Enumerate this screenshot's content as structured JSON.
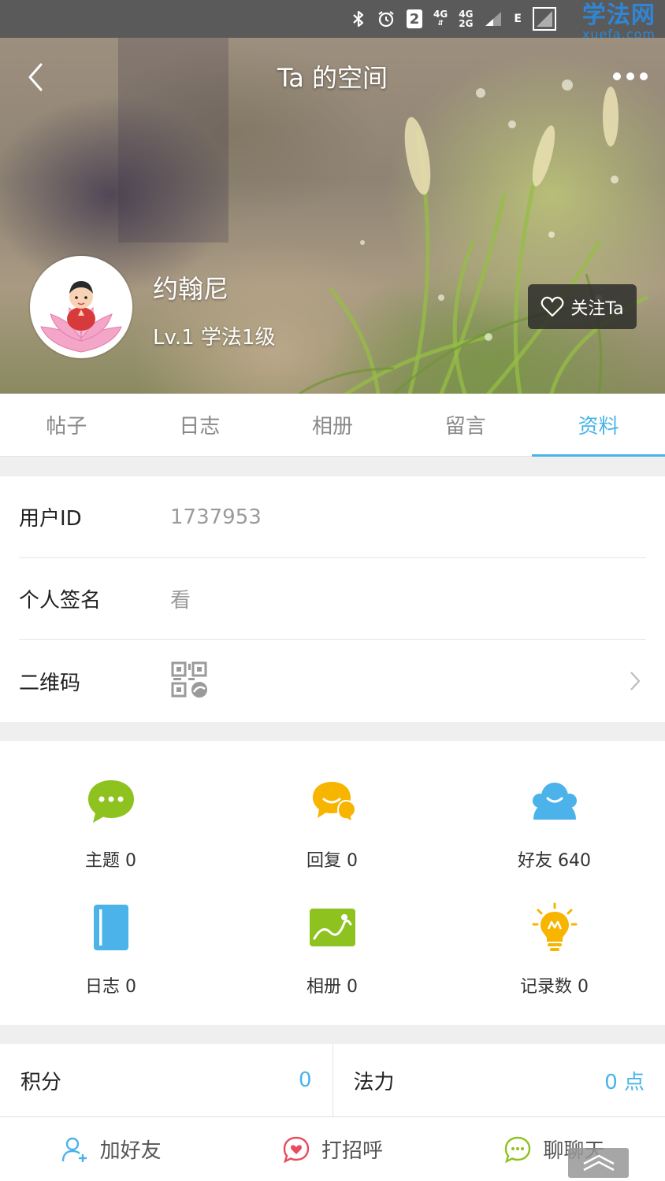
{
  "status_bar": {
    "sim_badge": "2",
    "net1": "4G",
    "net2_top": "4G",
    "net2_bottom": "2G",
    "net3": "E"
  },
  "watermark": {
    "logo": "学法网",
    "url": "xuefa.com"
  },
  "header": {
    "title": "Ta 的空间",
    "username": "约翰尼",
    "level": "Lv.1 学法1级",
    "follow_label": "关注Ta"
  },
  "tabs": [
    {
      "label": "帖子"
    },
    {
      "label": "日志"
    },
    {
      "label": "相册"
    },
    {
      "label": "留言"
    },
    {
      "label": "资料",
      "active": true
    }
  ],
  "profile": {
    "user_id_label": "用户ID",
    "user_id_value": "1737953",
    "signature_label": "个人签名",
    "signature_value": "看",
    "qrcode_label": "二维码"
  },
  "stats": [
    {
      "label": "主题",
      "value": "0",
      "icon": "chat-bubble-icon",
      "color": "#8dc21f"
    },
    {
      "label": "回复",
      "value": "0",
      "icon": "reply-bubbles-icon",
      "color": "#f7b500"
    },
    {
      "label": "好友",
      "value": "640",
      "icon": "friends-icon",
      "color": "#4bb2ea"
    },
    {
      "label": "日志",
      "value": "0",
      "icon": "notebook-icon",
      "color": "#4bb2ea"
    },
    {
      "label": "相册",
      "value": "0",
      "icon": "photo-album-icon",
      "color": "#8dc21f"
    },
    {
      "label": "记录数",
      "value": "0",
      "icon": "lightbulb-icon",
      "color": "#f7b500"
    }
  ],
  "points": {
    "score_label": "积分",
    "score_value": "0",
    "power_label": "法力",
    "power_value": "0 点"
  },
  "bottom_bar": {
    "add_friend": "加好友",
    "greet": "打招呼",
    "chat": "聊聊天"
  },
  "colors": {
    "accent": "#49b4e8",
    "green": "#8dc21f",
    "orange": "#f7b500",
    "blue": "#4bb2ea"
  }
}
